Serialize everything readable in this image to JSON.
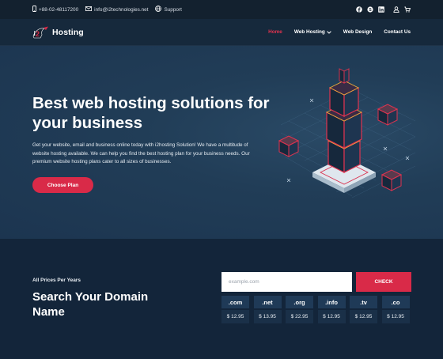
{
  "topbar": {
    "phone": "+88-02-48117200",
    "email": "info@i2technologies.net",
    "support": "Support",
    "icons": [
      "phone-icon",
      "mail-icon",
      "globe-icon",
      "facebook-icon",
      "skype-icon",
      "linkedin-icon",
      "user-icon",
      "cart-icon"
    ]
  },
  "nav": {
    "logo_text": "Hosting",
    "items": [
      {
        "label": "Home",
        "active": true
      },
      {
        "label": "Web Hosting",
        "has_dropdown": true
      },
      {
        "label": "Web Design"
      },
      {
        "label": "Contact Us"
      }
    ]
  },
  "hero": {
    "title": "Best web hosting solutions for your business",
    "description": "Get your website, email and business online today with i2hosting Solution! We have a multitude of website hosting available. We can help you find the best hosting plan for your business needs. Our premium website hosting plans cater to all sizes of businesses.",
    "cta": "Choose Plan"
  },
  "domain": {
    "subtitle": "All Prices Per Years",
    "title": "Search Your Domain Name",
    "placeholder": "example.com",
    "check_label": "CHECK",
    "tlds": [
      {
        "ext": ".com",
        "price": "$ 12.95"
      },
      {
        "ext": ".net",
        "price": "$ 13.95"
      },
      {
        "ext": ".org",
        "price": "$ 22.95"
      },
      {
        "ext": ".info",
        "price": "$ 12.95"
      },
      {
        "ext": ".tv",
        "price": "$ 12.95"
      },
      {
        "ext": ".co",
        "price": "$ 12.95"
      }
    ]
  },
  "colors": {
    "accent": "#d92a48",
    "background_dark": "#13212f",
    "hero": "#213d57"
  }
}
